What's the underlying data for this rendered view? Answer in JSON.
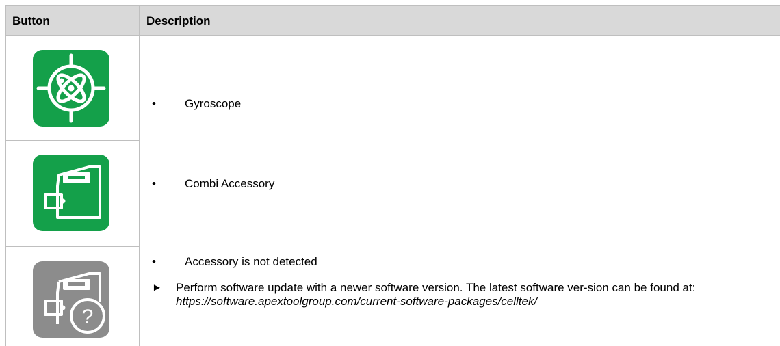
{
  "table": {
    "headers": {
      "button": "Button",
      "description": "Description"
    },
    "rows": [
      {
        "icon": "gyroscope-icon",
        "icon_color": "#14a04a",
        "bullet": "•",
        "text": "Gyroscope"
      },
      {
        "icon": "combi-accessory-icon",
        "icon_color": "#14a04a",
        "bullet": "•",
        "text": "Combi Accessory"
      },
      {
        "icon": "accessory-unknown-icon",
        "icon_color": "#8c8c8c",
        "bullet": "•",
        "text": "Accessory is not detected",
        "step_marker": "►",
        "step_text": "Perform software update with a newer software version. The latest software ver-sion can be found at:",
        "url": "https://software.apextoolgroup.com/current-software-packages/celltek/"
      }
    ]
  }
}
